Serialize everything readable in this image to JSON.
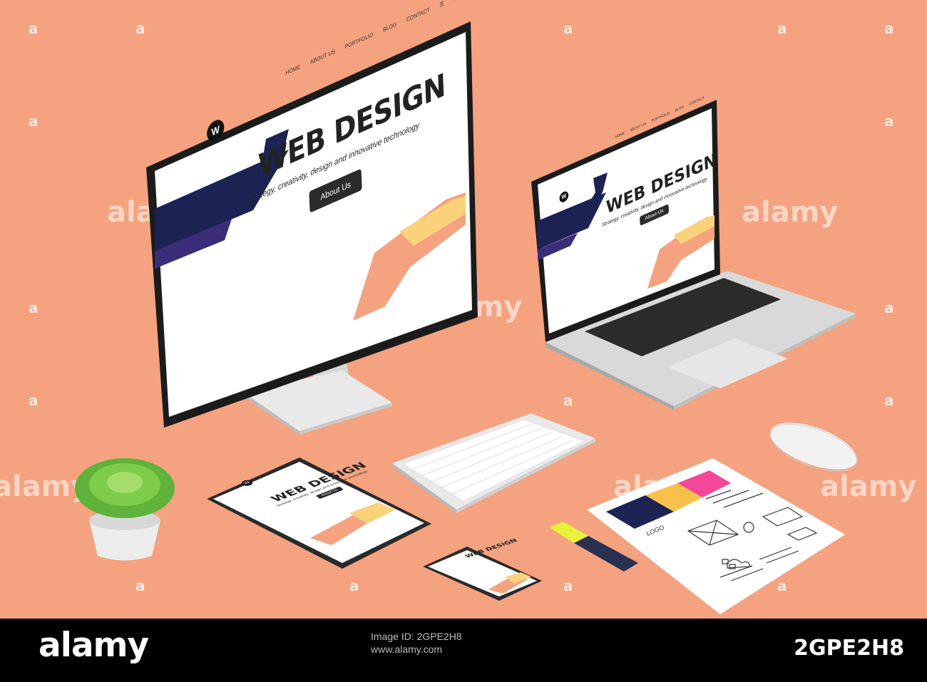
{
  "site": {
    "nav": [
      "HOME",
      "ABOUT US",
      "PORTFOLIO",
      "BLOG",
      "CONTACT"
    ],
    "logo_letter": "W",
    "hero_title": "WEB DESIGN",
    "hero_subtitle": "Strategy, creativity, design and innovative technology",
    "hero_button": "About Us",
    "colors": {
      "navy": "#1c2354",
      "purple": "#3b2d7a",
      "peach": "#f4a27f",
      "yellow": "#f9d27a",
      "background": "#f4a27f"
    }
  },
  "sketch": {
    "logo_text": "LOGO"
  },
  "watermark": {
    "text": "alamy"
  },
  "footer": {
    "brand": "alamy",
    "image_id": "2GPE2H8",
    "lines": [
      "Image ID: 2GPE2H8",
      "www.alamy.com"
    ]
  }
}
